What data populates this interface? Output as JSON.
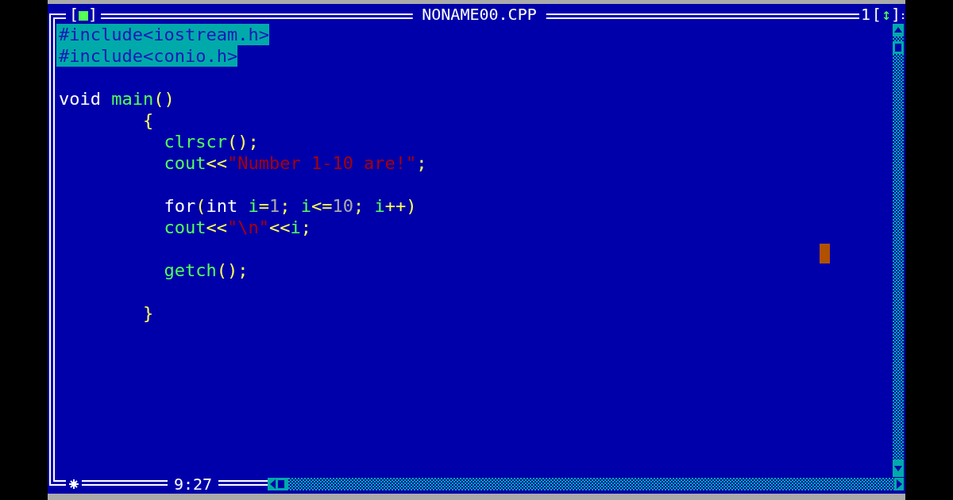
{
  "window": {
    "close_button": "[■]",
    "title": "NONAME00.CPP",
    "window_number": "1",
    "zoom_button": "[↕]"
  },
  "editor": {
    "lines": [
      {
        "selected": true,
        "segments": [
          {
            "kind": "plain",
            "text": "#include<iostream.h>"
          }
        ]
      },
      {
        "selected": true,
        "segments": [
          {
            "kind": "plain",
            "text": "#include<conio.h>"
          }
        ]
      },
      {
        "selected": false
      },
      {
        "selected": false,
        "segments": [
          {
            "kind": "keyword",
            "text": "void "
          },
          {
            "kind": "ident",
            "text": "main"
          },
          {
            "kind": "symbol",
            "text": "()"
          }
        ]
      },
      {
        "selected": false,
        "segments": [
          {
            "kind": "symbol",
            "text": "        {"
          }
        ]
      },
      {
        "selected": false,
        "segments": [
          {
            "kind": "ident",
            "text": "          clrscr"
          },
          {
            "kind": "symbol",
            "text": "();"
          }
        ]
      },
      {
        "selected": false,
        "segments": [
          {
            "kind": "ident",
            "text": "          cout"
          },
          {
            "kind": "symbol",
            "text": "<<"
          },
          {
            "kind": "string",
            "text": "\"Number 1-10 are!\""
          },
          {
            "kind": "symbol",
            "text": ";"
          }
        ]
      },
      {
        "selected": false
      },
      {
        "selected": false,
        "segments": [
          {
            "kind": "keyword",
            "text": "          for"
          },
          {
            "kind": "symbol",
            "text": "("
          },
          {
            "kind": "keyword",
            "text": "int "
          },
          {
            "kind": "ident",
            "text": "i"
          },
          {
            "kind": "symbol",
            "text": "="
          },
          {
            "kind": "number",
            "text": "1"
          },
          {
            "kind": "symbol",
            "text": "; "
          },
          {
            "kind": "ident",
            "text": "i"
          },
          {
            "kind": "symbol",
            "text": "<="
          },
          {
            "kind": "number",
            "text": "10"
          },
          {
            "kind": "symbol",
            "text": "; "
          },
          {
            "kind": "ident",
            "text": "i"
          },
          {
            "kind": "symbol",
            "text": "++)"
          }
        ]
      },
      {
        "selected": false,
        "segments": [
          {
            "kind": "ident",
            "text": "          cout"
          },
          {
            "kind": "symbol",
            "text": "<<"
          },
          {
            "kind": "string",
            "text": "\"\\n\""
          },
          {
            "kind": "symbol",
            "text": "<<"
          },
          {
            "kind": "ident",
            "text": "i"
          },
          {
            "kind": "symbol",
            "text": ";"
          }
        ]
      },
      {
        "selected": false
      },
      {
        "selected": false,
        "segments": [
          {
            "kind": "ident",
            "text": "          getch"
          },
          {
            "kind": "symbol",
            "text": "();"
          }
        ]
      },
      {
        "selected": false
      },
      {
        "selected": false,
        "segments": [
          {
            "kind": "symbol",
            "text": "        }"
          }
        ]
      }
    ]
  },
  "status": {
    "cursor_position": "9:27"
  }
}
